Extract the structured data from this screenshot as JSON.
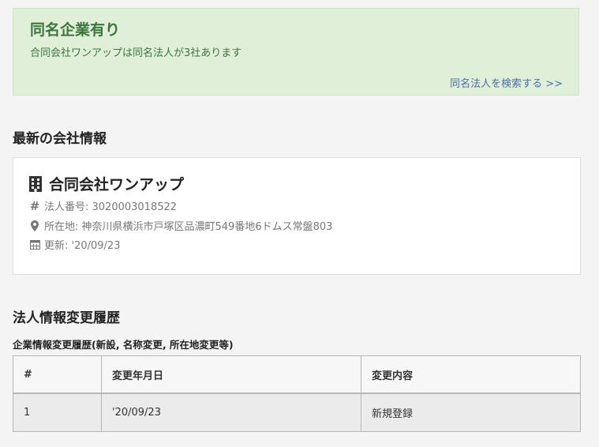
{
  "alert": {
    "title": "同名企業有り",
    "text": "合同会社ワンアップは同名法人が3社あります",
    "link": "同名法人を検索する >>"
  },
  "latest": {
    "heading": "最新の会社情報",
    "company_name": "合同会社ワンアップ",
    "corp_number": "法人番号: 3020003018522",
    "address": "所在地: 神奈川県横浜市戸塚区品濃町549番地6ドムス常盤803",
    "updated": "更新: '20/09/23"
  },
  "history": {
    "heading": "法人情報変更履歴",
    "subheading": "企業情報変更履歴(新設, 名称変更, 所在地変更等)",
    "columns": [
      "#",
      "変更年月日",
      "変更内容"
    ],
    "rows": [
      [
        "1",
        "'20/09/23",
        "新規登録"
      ]
    ]
  },
  "icons": {
    "company": "building-icon",
    "number": "hash-icon",
    "address": "map-marker-icon",
    "updated": "calendar-icon"
  },
  "colors": {
    "alert_bg": "#dfefd8",
    "alert_text": "#3c763d",
    "link": "#4a6fa5"
  }
}
